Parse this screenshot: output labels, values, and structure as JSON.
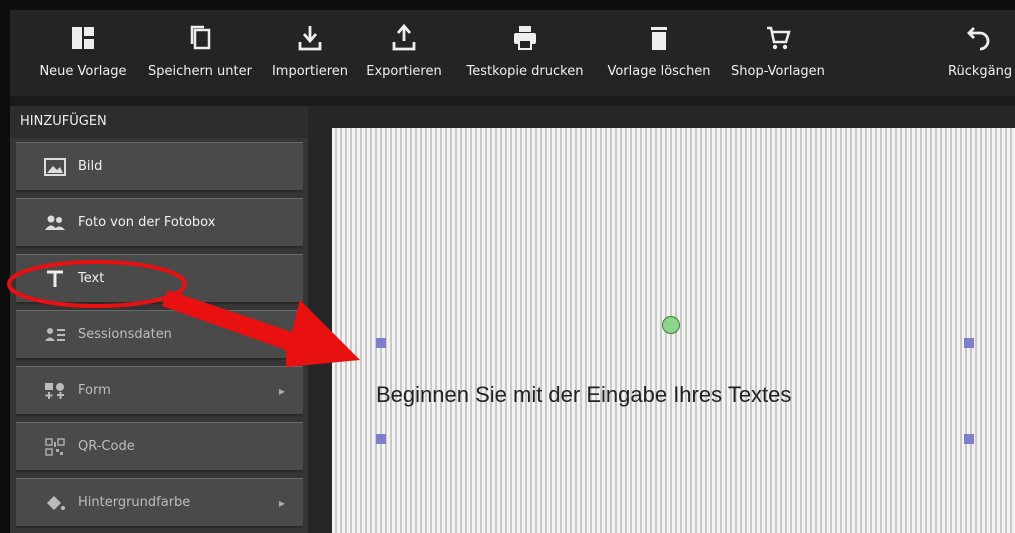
{
  "toolbar": {
    "new_template": "Neue Vorlage",
    "save_as": "Speichern unter",
    "import": "Importieren",
    "export": "Exportieren",
    "test_print": "Testkopie drucken",
    "delete_template": "Vorlage löschen",
    "shop_templates": "Shop-Vorlagen",
    "undo": "Rückgäng"
  },
  "sidebar": {
    "header": "HINZUFÜGEN",
    "items": [
      {
        "label": "Bild",
        "icon": "image-icon"
      },
      {
        "label": "Foto von der Fotobox",
        "icon": "people-icon"
      },
      {
        "label": "Text",
        "icon": "text-icon"
      },
      {
        "label": "Sessionsdaten",
        "icon": "session-icon"
      },
      {
        "label": "Form",
        "icon": "shapes-icon"
      },
      {
        "label": "QR-Code",
        "icon": "qr-code-icon"
      },
      {
        "label": "Hintergrundfarbe",
        "icon": "paint-bucket-icon"
      }
    ]
  },
  "canvas": {
    "placeholder_text": "Beginnen Sie mit der Eingabe Ihres Textes"
  },
  "colors": {
    "annotation": "#e81010",
    "handle": "#7d7fc9",
    "rotate_handle": "#8ed38c"
  }
}
